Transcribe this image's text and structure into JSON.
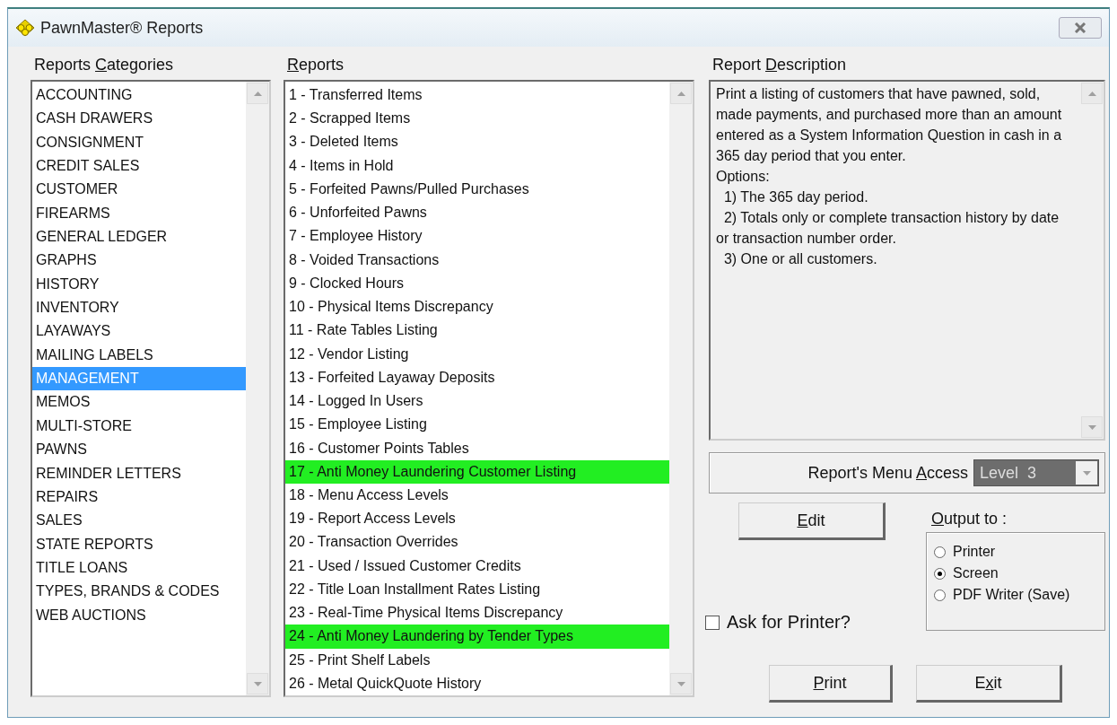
{
  "window": {
    "title": "PawnMaster® Reports"
  },
  "categories": {
    "label": {
      "pre": "Reports ",
      "key": "C",
      "post": "ategories"
    },
    "items": [
      {
        "text": "ACCOUNTING",
        "selected": false
      },
      {
        "text": "CASH DRAWERS",
        "selected": false
      },
      {
        "text": "CONSIGNMENT",
        "selected": false
      },
      {
        "text": "CREDIT SALES",
        "selected": false
      },
      {
        "text": "CUSTOMER",
        "selected": false
      },
      {
        "text": "FIREARMS",
        "selected": false
      },
      {
        "text": "GENERAL LEDGER",
        "selected": false
      },
      {
        "text": "GRAPHS",
        "selected": false
      },
      {
        "text": "HISTORY",
        "selected": false
      },
      {
        "text": "INVENTORY",
        "selected": false
      },
      {
        "text": "LAYAWAYS",
        "selected": false
      },
      {
        "text": "MAILING LABELS",
        "selected": false
      },
      {
        "text": "MANAGEMENT",
        "selected": true
      },
      {
        "text": "MEMOS",
        "selected": false
      },
      {
        "text": "MULTI-STORE",
        "selected": false
      },
      {
        "text": "PAWNS",
        "selected": false
      },
      {
        "text": "REMINDER LETTERS",
        "selected": false
      },
      {
        "text": "REPAIRS",
        "selected": false
      },
      {
        "text": "SALES",
        "selected": false
      },
      {
        "text": "STATE REPORTS",
        "selected": false
      },
      {
        "text": "TITLE LOANS",
        "selected": false
      },
      {
        "text": "TYPES, BRANDS & CODES",
        "selected": false
      },
      {
        "text": "WEB AUCTIONS",
        "selected": false
      }
    ]
  },
  "reports": {
    "label": {
      "key": "R",
      "post": "eports"
    },
    "items": [
      {
        "text": "1 - Transferred Items",
        "highlighted": false
      },
      {
        "text": "2 - Scrapped Items",
        "highlighted": false
      },
      {
        "text": "3 - Deleted Items",
        "highlighted": false
      },
      {
        "text": "4 - Items in Hold",
        "highlighted": false
      },
      {
        "text": "5 - Forfeited Pawns/Pulled Purchases",
        "highlighted": false
      },
      {
        "text": "6 - Unforfeited Pawns",
        "highlighted": false
      },
      {
        "text": "7 - Employee History",
        "highlighted": false
      },
      {
        "text": "8 - Voided Transactions",
        "highlighted": false
      },
      {
        "text": "9 - Clocked Hours",
        "highlighted": false
      },
      {
        "text": "10 - Physical Items Discrepancy",
        "highlighted": false
      },
      {
        "text": "11 - Rate Tables Listing",
        "highlighted": false
      },
      {
        "text": "12 - Vendor Listing",
        "highlighted": false
      },
      {
        "text": "13 - Forfeited Layaway Deposits",
        "highlighted": false
      },
      {
        "text": "14 - Logged In Users",
        "highlighted": false
      },
      {
        "text": "15 - Employee Listing",
        "highlighted": false
      },
      {
        "text": "16 - Customer Points Tables",
        "highlighted": false
      },
      {
        "text": "17 - Anti Money Laundering Customer Listing",
        "highlighted": true
      },
      {
        "text": "18 - Menu Access Levels",
        "highlighted": false
      },
      {
        "text": "19 - Report Access Levels",
        "highlighted": false
      },
      {
        "text": "20 - Transaction Overrides",
        "highlighted": false
      },
      {
        "text": "21 - Used / Issued Customer Credits",
        "highlighted": false
      },
      {
        "text": "22 - Title Loan Installment Rates Listing",
        "highlighted": false
      },
      {
        "text": "23 - Real-Time Physical Items Discrepancy",
        "highlighted": false
      },
      {
        "text": "24 - Anti Money Laundering by Tender Types",
        "highlighted": true
      },
      {
        "text": "25 - Print Shelf Labels",
        "highlighted": false
      },
      {
        "text": "26 - Metal QuickQuote History",
        "highlighted": false
      }
    ]
  },
  "description": {
    "label": {
      "pre": "Report ",
      "key": "D",
      "post": "escription"
    },
    "lines": [
      "Print a listing of customers that have pawned, sold, made payments, and purchased more than an amount entered as a System Information Question in cash in a 365 day period that you enter.",
      "Options:",
      "  1) The 365 day period.",
      "  2) Totals only or complete transaction history by date or transaction number order.",
      "  3) One or all customers."
    ]
  },
  "menu_access": {
    "label": {
      "pre": "Report's Menu ",
      "key": "A",
      "post": "ccess"
    },
    "value": "Level  3"
  },
  "edit_button": {
    "key": "E",
    "post": "dit"
  },
  "output": {
    "label": {
      "key": "O",
      "post": "utput to :"
    },
    "options": [
      {
        "text": "Printer",
        "selected": false
      },
      {
        "text": "Screen",
        "selected": true
      },
      {
        "text": "PDF Writer (Save)",
        "selected": false
      }
    ]
  },
  "ask_for_printer": {
    "text": "Ask for Printer?",
    "checked": false
  },
  "print_button": {
    "key": "P",
    "post": "rint"
  },
  "exit_button": {
    "pre": "E",
    "key": "x",
    "post": "it"
  }
}
